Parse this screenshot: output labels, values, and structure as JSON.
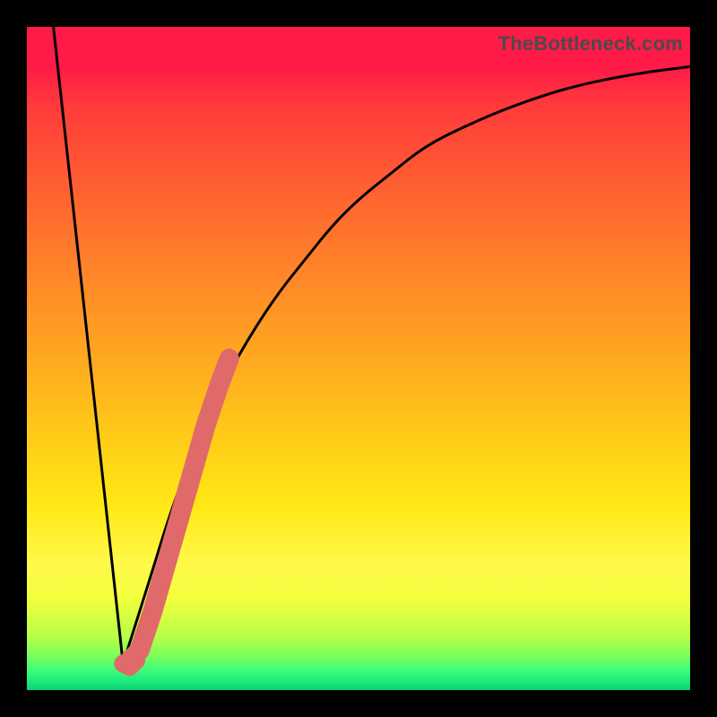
{
  "watermark": "TheBottleneck.com",
  "colors": {
    "curve_black": "#000000",
    "highlight": "#e06a6a",
    "frame_bg": "#000000"
  },
  "chart_data": {
    "type": "line",
    "title": "",
    "xlabel": "",
    "ylabel": "",
    "xlim": [
      0,
      100
    ],
    "ylim": [
      0,
      100
    ],
    "grid": false,
    "legend": false,
    "series": [
      {
        "name": "left-descent",
        "color": "#000000",
        "x": [
          4,
          14.5
        ],
        "values": [
          100,
          4
        ]
      },
      {
        "name": "right-ascent",
        "color": "#000000",
        "x": [
          14.5,
          18,
          22,
          26,
          30,
          34,
          38,
          42,
          46,
          50,
          55,
          60,
          66,
          73,
          82,
          92,
          100
        ],
        "values": [
          4,
          15,
          28,
          38,
          47,
          54,
          60,
          65,
          70,
          74,
          78,
          82,
          85,
          88,
          91,
          93,
          94
        ]
      },
      {
        "name": "highlight-segment",
        "color": "#e06a6a",
        "x": [
          15.5,
          17,
          19,
          21,
          23,
          25,
          27,
          29,
          30.5
        ],
        "values": [
          4.5,
          6,
          12,
          19,
          26,
          33,
          40,
          46,
          50
        ]
      },
      {
        "name": "highlight-cap-bottom",
        "color": "#e06a6a",
        "x": [
          14.5,
          15.5,
          16.5
        ],
        "values": [
          4,
          3.5,
          4.5
        ]
      }
    ],
    "annotations": []
  }
}
